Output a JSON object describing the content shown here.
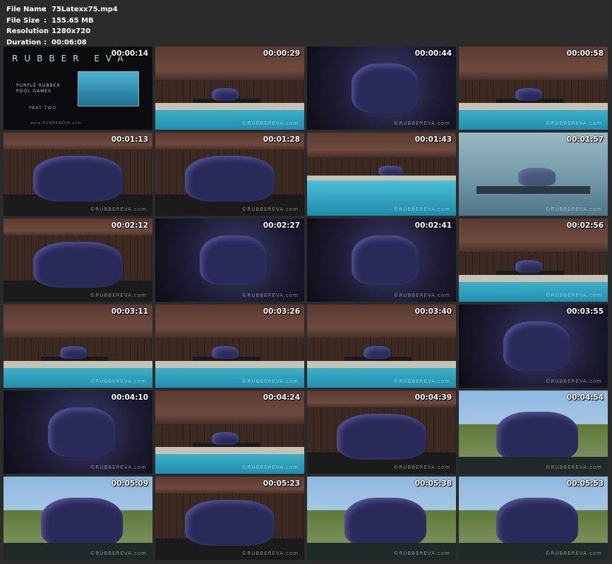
{
  "file_info": [
    {
      "label": "File Name",
      "value": "75Latexx75.mp4"
    },
    {
      "label": "File Size",
      "value": "155.65 MB"
    },
    {
      "label": "Resolution",
      "value": "1280x720"
    },
    {
      "label": "Duration",
      "value": "00:06:08"
    }
  ],
  "separator": ":",
  "watermark": "©RUBBEREVA.com",
  "intro": {
    "logo": "RUBBER EVA",
    "line1": "PURPLE RUBBER",
    "line2": "POOL GAMES",
    "line3": "PART TWO",
    "url": "www.RUBBEREVA.com"
  },
  "thumbnails": [
    {
      "time": "00:00:14",
      "scene": "intro"
    },
    {
      "time": "00:00:29",
      "scene": "poolside"
    },
    {
      "time": "00:00:44",
      "scene": "dark"
    },
    {
      "time": "00:00:58",
      "scene": "poolside"
    },
    {
      "time": "00:01:13",
      "scene": "close"
    },
    {
      "time": "00:01:28",
      "scene": "close"
    },
    {
      "time": "00:01:43",
      "scene": "poolhigh"
    },
    {
      "time": "00:01:57",
      "scene": "underwater"
    },
    {
      "time": "00:02:12",
      "scene": "close"
    },
    {
      "time": "00:02:27",
      "scene": "dark"
    },
    {
      "time": "00:02:41",
      "scene": "dark"
    },
    {
      "time": "00:02:56",
      "scene": "poolside"
    },
    {
      "time": "00:03:11",
      "scene": "poolside"
    },
    {
      "time": "00:03:26",
      "scene": "poolside"
    },
    {
      "time": "00:03:40",
      "scene": "poolside"
    },
    {
      "time": "00:03:55",
      "scene": "dark"
    },
    {
      "time": "00:04:10",
      "scene": "dark"
    },
    {
      "time": "00:04:24",
      "scene": "poolside"
    },
    {
      "time": "00:04:39",
      "scene": "close"
    },
    {
      "time": "00:04:54",
      "scene": "garden"
    },
    {
      "time": "00:05:09",
      "scene": "garden"
    },
    {
      "time": "00:05:23",
      "scene": "close"
    },
    {
      "time": "00:05:38",
      "scene": "garden"
    },
    {
      "time": "00:05:53",
      "scene": "garden"
    }
  ]
}
